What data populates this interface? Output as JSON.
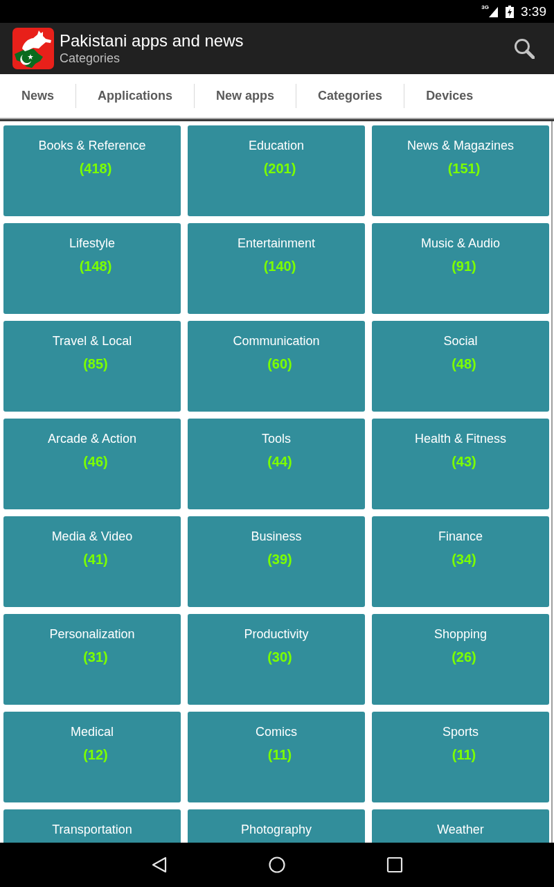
{
  "status_bar": {
    "network": "3G",
    "time": "3:39"
  },
  "app_bar": {
    "title": "Pakistani apps and news",
    "subtitle": "Categories"
  },
  "tabs": [
    "News",
    "Applications",
    "New apps",
    "Categories",
    "Devices"
  ],
  "categories": [
    {
      "name": "Books & Reference",
      "count": "(418)"
    },
    {
      "name": "Education",
      "count": "(201)"
    },
    {
      "name": "News & Magazines",
      "count": "(151)"
    },
    {
      "name": "Lifestyle",
      "count": "(148)"
    },
    {
      "name": "Entertainment",
      "count": "(140)"
    },
    {
      "name": "Music & Audio",
      "count": "(91)"
    },
    {
      "name": "Travel & Local",
      "count": "(85)"
    },
    {
      "name": "Communication",
      "count": "(60)"
    },
    {
      "name": "Social",
      "count": "(48)"
    },
    {
      "name": "Arcade & Action",
      "count": "(46)"
    },
    {
      "name": "Tools",
      "count": "(44)"
    },
    {
      "name": "Health & Fitness",
      "count": "(43)"
    },
    {
      "name": "Media & Video",
      "count": "(41)"
    },
    {
      "name": "Business",
      "count": "(39)"
    },
    {
      "name": "Finance",
      "count": "(34)"
    },
    {
      "name": "Personalization",
      "count": "(31)"
    },
    {
      "name": "Productivity",
      "count": "(30)"
    },
    {
      "name": "Shopping",
      "count": "(26)"
    },
    {
      "name": "Medical",
      "count": "(12)"
    },
    {
      "name": "Comics",
      "count": "(11)"
    },
    {
      "name": "Sports",
      "count": "(11)"
    },
    {
      "name": "Transportation"
    },
    {
      "name": "Photography"
    },
    {
      "name": "Weather"
    }
  ]
}
